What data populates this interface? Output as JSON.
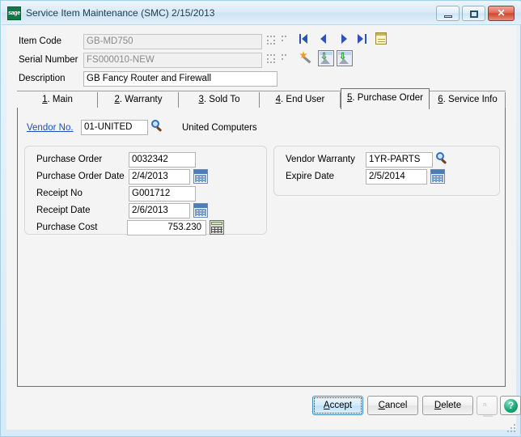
{
  "window": {
    "title": "Service Item Maintenance (SMC) 2/15/2013",
    "logo_text": "sage",
    "logo_icon": "sage-logo-icon",
    "minimize_icon": "minimize-icon",
    "maximize_icon": "maximize-icon",
    "close_label": "✕",
    "accent_blue": "#2a55b4",
    "frame_blue": "#9fd0ea",
    "client_bg": "#f4f4f4"
  },
  "header": {
    "item_code": {
      "label": "Item Code",
      "value": "GB-MD750",
      "disabled": true
    },
    "serial_number": {
      "label": "Serial Number",
      "value": "FS000010-NEW",
      "disabled": true
    },
    "description": {
      "label": "Description",
      "value": "GB Fancy Router and Firewall",
      "disabled": false
    }
  },
  "toolbar": {
    "first_icon": "first-record-icon",
    "prev_icon": "previous-record-icon",
    "next_icon": "next-record-icon",
    "last_icon": "last-record-icon",
    "memo_icon": "memo-icon",
    "wand_icon": "wand-icon",
    "image1_icon": "insert-image-icon",
    "image2_icon": "insert-image-icon"
  },
  "tabs": [
    {
      "num": "1",
      "label": ". Main",
      "active": false
    },
    {
      "num": "2",
      "label": ". Warranty",
      "active": false
    },
    {
      "num": "3",
      "label": ". Sold To",
      "active": false
    },
    {
      "num": "4",
      "label": ". End User",
      "active": false
    },
    {
      "num": "5",
      "label": ". Purchase Order",
      "active": true
    },
    {
      "num": "6",
      "label": ". Service Info",
      "active": false
    }
  ],
  "vendor": {
    "link_label": "Vendor No.",
    "value": "01-UNITED",
    "lookup_icon": "search-icon",
    "name": "United Computers"
  },
  "purchase_panel": {
    "purchase_order": {
      "label": "Purchase Order",
      "value": "0032342"
    },
    "purchase_order_date": {
      "label": "Purchase Order Date",
      "value": "2/4/2013",
      "icon": "calendar-icon"
    },
    "receipt_no": {
      "label": "Receipt No",
      "value": "G001712"
    },
    "receipt_date": {
      "label": "Receipt Date",
      "value": "2/6/2013",
      "icon": "calendar-icon"
    },
    "purchase_cost": {
      "label": "Purchase Cost",
      "value": "753.230",
      "icon": "calculator-icon"
    }
  },
  "warranty_panel": {
    "vendor_warranty": {
      "label": "Vendor Warranty",
      "value": "1YR-PARTS",
      "icon": "search-icon"
    },
    "expire_date": {
      "label": "Expire Date",
      "value": "2/5/2014",
      "icon": "calendar-icon"
    }
  },
  "footer": {
    "accept": {
      "mn": "A",
      "rest": "ccept",
      "default": true
    },
    "cancel": {
      "mn": "C",
      "rest": "ancel"
    },
    "delete": {
      "mn": "D",
      "rest": "elete"
    },
    "flag_icon": "flag-icon",
    "help_label": "?",
    "help_icon": "help-icon"
  }
}
